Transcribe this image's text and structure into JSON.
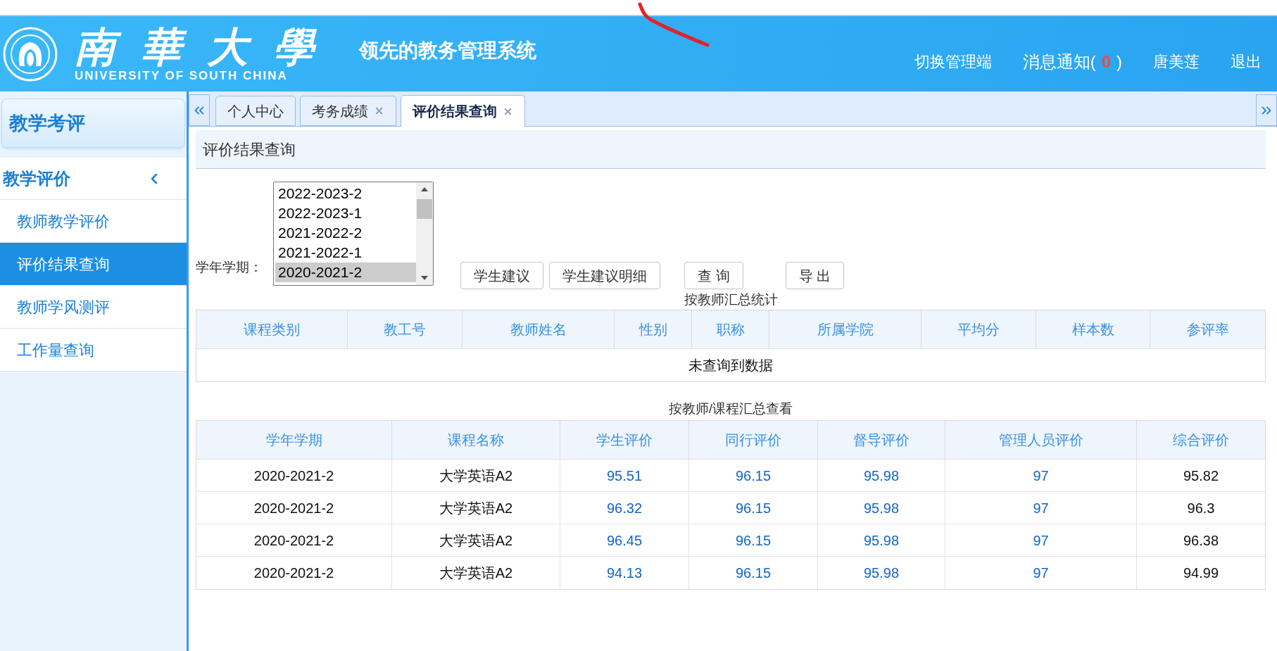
{
  "header": {
    "logo_name": "南華大學",
    "logo_subtitle": "UNIVERSITY OF SOUTH CHINA",
    "slogan": "领先的教务管理系统",
    "nav": [
      {
        "kind": "link",
        "label": "切换管理端"
      },
      {
        "kind": "notice",
        "label": "消息通知(",
        "count": "0",
        "close": ")"
      },
      {
        "kind": "link",
        "label": "唐美莲"
      },
      {
        "kind": "link",
        "label": "退出"
      }
    ]
  },
  "sidebar": {
    "title": "教学考评",
    "group": {
      "label": "教学评价",
      "expanded": true,
      "items": [
        {
          "label": "教师教学评价",
          "selected": false
        },
        {
          "label": "评价结果查询",
          "selected": true
        },
        {
          "label": "教师学风测评",
          "selected": false
        },
        {
          "label": "工作量查询",
          "selected": false
        }
      ]
    }
  },
  "tabs": [
    {
      "label": "个人中心",
      "closable": false,
      "selected": false
    },
    {
      "label": "考务成绩",
      "closable": true,
      "selected": false
    },
    {
      "label": "评价结果查询",
      "closable": true,
      "selected": true
    }
  ],
  "page_title": "评价结果查询",
  "form": {
    "label": "学年学期：",
    "options": [
      {
        "label": "2022-2023-2",
        "selected": false
      },
      {
        "label": "2022-2023-1",
        "selected": false
      },
      {
        "label": "2021-2022-2",
        "selected": false
      },
      {
        "label": "2021-2022-1",
        "selected": false
      },
      {
        "label": "2020-2021-2",
        "selected": true
      }
    ],
    "buttons": [
      "学生建议",
      "学生建议明细",
      "查 询",
      "导 出"
    ]
  },
  "teacher_table": {
    "caption": "按教师汇总统计",
    "columns": [
      "课程类别",
      "教工号",
      "教师姓名",
      "性别",
      "职称",
      "所属学院",
      "平均分",
      "样本数",
      "参评率"
    ],
    "empty_message": "未查询到数据"
  },
  "course_table": {
    "caption": "按教师/课程汇总查看",
    "columns": [
      {
        "label": "学年学期",
        "kind": "text"
      },
      {
        "label": "课程名称",
        "kind": "text"
      },
      {
        "label": "学生评价",
        "kind": "link"
      },
      {
        "label": "同行评价",
        "kind": "link"
      },
      {
        "label": "督导评价",
        "kind": "link"
      },
      {
        "label": "管理人员评价",
        "kind": "link"
      },
      {
        "label": "综合评价",
        "kind": "text"
      }
    ],
    "rows": [
      [
        "2020-2021-2",
        "大学英语A2",
        "95.51",
        "96.15",
        "95.98",
        "97",
        "95.82"
      ],
      [
        "2020-2021-2",
        "大学英语A2",
        "96.32",
        "96.15",
        "95.98",
        "97",
        "96.3"
      ],
      [
        "2020-2021-2",
        "大学英语A2",
        "96.45",
        "96.15",
        "95.98",
        "97",
        "96.38"
      ],
      [
        "2020-2021-2",
        "大学英语A2",
        "94.13",
        "96.15",
        "95.98",
        "97",
        "94.99"
      ]
    ]
  }
}
